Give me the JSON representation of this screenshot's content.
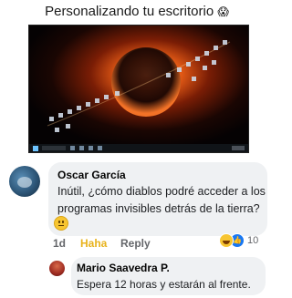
{
  "post": {
    "title": "Personalizando tu escritorio",
    "title_emoji": "😱",
    "image": {
      "description_icon": "desktop-wallpaper-icon",
      "colors": {
        "planet_glow": "#ff6a1a",
        "background": "#050203",
        "taskbar": "#101418"
      }
    }
  },
  "comments": [
    {
      "author": "Oscar García",
      "text": "Inútil, ¿cómo diablos podré acceder a los programas invisibles detrás de la tierra?",
      "emoji": "neutral-face-icon",
      "time": "1d",
      "reaction_label": "Haha",
      "reply_label": "Reply",
      "reaction_count": "10"
    },
    {
      "author": "Mario Saavedra P.",
      "text": "Espera 12 horas y estarán al frente."
    }
  ],
  "colors": {
    "haha": "#e8b31d",
    "like": "#1877f2",
    "bubble": "#eff1f3",
    "muted": "#65676b"
  }
}
